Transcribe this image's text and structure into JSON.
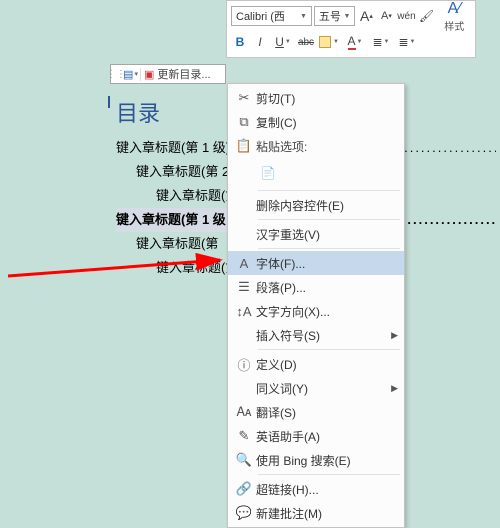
{
  "toolbar": {
    "font_name": "Calibri (西",
    "font_size": "五号",
    "grow_font": "A",
    "shrink_font": "A",
    "phonetic": "wén",
    "bold": "B",
    "italic": "I",
    "underline": "U",
    "strike": "abc",
    "font_color": "A",
    "highlight": "A",
    "styles_label": "样式"
  },
  "toc_bar": {
    "update_label": "更新目录..."
  },
  "doc": {
    "title": "目录",
    "lines": [
      {
        "text": "键入章标题(第 1 级)",
        "level": 1
      },
      {
        "text": "键入章标题(第 2",
        "level": 2
      },
      {
        "text": "键入章标题(第",
        "level": 3
      },
      {
        "text": "键入章标题(第 1 级",
        "level": 1,
        "selected": true
      },
      {
        "text": "键入章标题(第",
        "level": 2
      },
      {
        "text": "键入章标题(第",
        "level": 3
      }
    ]
  },
  "ctx": {
    "cut": "剪切(T)",
    "copy": "复制(C)",
    "paste_header": "粘贴选项:",
    "delete_control": "删除内容控件(E)",
    "reconvert": "汉字重选(V)",
    "font": "字体(F)...",
    "paragraph": "段落(P)...",
    "text_direction": "文字方向(X)...",
    "insert_symbol": "插入符号(S)",
    "define": "定义(D)",
    "synonyms": "同义词(Y)",
    "translate": "翻译(S)",
    "english_assistant": "英语助手(A)",
    "bing_search": "使用 Bing 搜索(E)",
    "hyperlink": "超链接(H)...",
    "new_comment": "新建批注(M)"
  }
}
